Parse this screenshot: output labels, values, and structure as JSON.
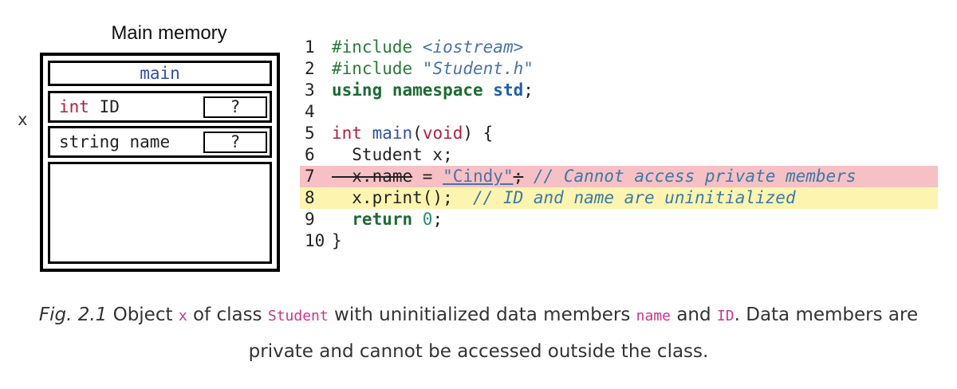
{
  "memory": {
    "title": "Main memory",
    "frame": "main",
    "variable": "x",
    "fields": [
      {
        "type": "int",
        "name": "ID",
        "value": "?"
      },
      {
        "type": "string",
        "name": "name",
        "value": "?"
      }
    ]
  },
  "code": {
    "lines": [
      {
        "n": "1",
        "parts": [
          [
            "pp",
            "#include "
          ],
          [
            "str",
            "<iostream>"
          ]
        ]
      },
      {
        "n": "2",
        "parts": [
          [
            "pp",
            "#include "
          ],
          [
            "str",
            "\"Student.h\""
          ]
        ]
      },
      {
        "n": "3",
        "parts": [
          [
            "kwb",
            "using namespace "
          ],
          [
            "std",
            "std"
          ],
          [
            "plain",
            ";"
          ]
        ]
      },
      {
        "n": "4",
        "parts": []
      },
      {
        "n": "5",
        "parts": [
          [
            "type",
            "int "
          ],
          [
            "fn",
            "main"
          ],
          [
            "plain",
            "("
          ],
          [
            "type",
            "void"
          ],
          [
            "plain",
            ") {"
          ]
        ]
      },
      {
        "n": "6",
        "parts": [
          [
            "plain",
            "  Student x;"
          ]
        ]
      },
      {
        "n": "7",
        "highlight": "red",
        "parts": [
          [
            "strike",
            "  x.name"
          ],
          [
            "plain",
            " = "
          ],
          [
            "strlit",
            "\"Cindy\""
          ],
          [
            "strike",
            ";"
          ],
          [
            "cmt",
            " // Cannot access private members"
          ]
        ]
      },
      {
        "n": "8",
        "highlight": "yellow",
        "parts": [
          [
            "plain",
            "  x.print();  "
          ],
          [
            "cmt",
            "// ID and name are uninitialized"
          ]
        ]
      },
      {
        "n": "9",
        "parts": [
          [
            "kwb",
            "  return "
          ],
          [
            "num",
            "0"
          ],
          [
            "plain",
            ";"
          ]
        ]
      },
      {
        "n": "10",
        "parts": [
          [
            "plain",
            "}"
          ]
        ]
      }
    ]
  },
  "caption": {
    "fig": "Fig. 2.1",
    "t1": " Object ",
    "c1": "x",
    "t2": " of class ",
    "c2": "Student",
    "t3": " with uninitialized data members ",
    "c3": "name",
    "t4": " and ",
    "c4": "ID",
    "t5": ". Data members are private and cannot be accessed outside the class."
  }
}
